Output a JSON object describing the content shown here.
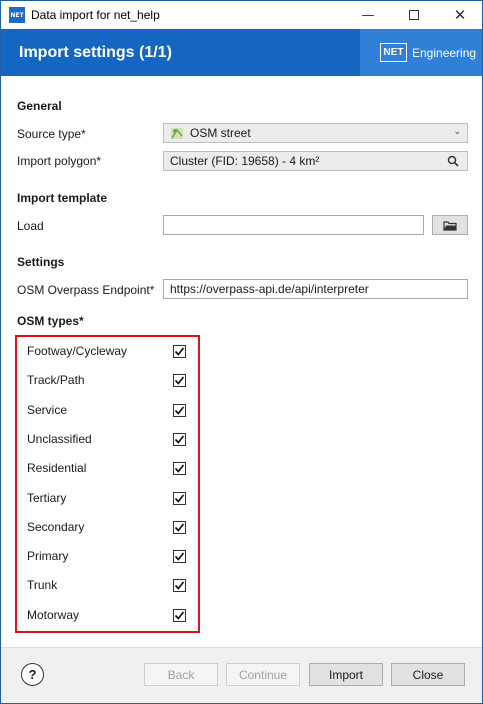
{
  "window": {
    "app_icon_text": "NET",
    "title": "Data import for net_help",
    "minimize_glyph": "—",
    "close_glyph": "✕"
  },
  "banner": {
    "title": "Import settings (1/1)",
    "brand_logo": "NET",
    "brand_text": "Engineering"
  },
  "general": {
    "heading": "General",
    "source_type_label": "Source type*",
    "source_type_value": "OSM street",
    "import_polygon_label": "Import polygon*",
    "import_polygon_value": "Cluster (FID: 19658) - 4 km²"
  },
  "import_template": {
    "heading": "Import template",
    "load_label": "Load",
    "load_value": ""
  },
  "settings": {
    "heading": "Settings",
    "endpoint_label": "OSM Overpass Endpoint*",
    "endpoint_value": "https://overpass-api.de/api/interpreter"
  },
  "osm_types": {
    "heading": "OSM types*",
    "items": [
      {
        "label": "Footway/Cycleway",
        "checked": true
      },
      {
        "label": "Track/Path",
        "checked": true
      },
      {
        "label": "Service",
        "checked": true
      },
      {
        "label": "Unclassified",
        "checked": true
      },
      {
        "label": "Residential",
        "checked": true
      },
      {
        "label": "Tertiary",
        "checked": true
      },
      {
        "label": "Secondary",
        "checked": true
      },
      {
        "label": "Primary",
        "checked": true
      },
      {
        "label": "Trunk",
        "checked": true
      },
      {
        "label": "Motorway",
        "checked": true
      }
    ],
    "highlight_color": "#e0121d"
  },
  "footer": {
    "help_label": "?",
    "back_label": "Back",
    "continue_label": "Continue",
    "import_label": "Import",
    "close_label": "Close"
  },
  "colors": {
    "banner": "#1466c0",
    "brand_panel": "#2f80d6"
  }
}
